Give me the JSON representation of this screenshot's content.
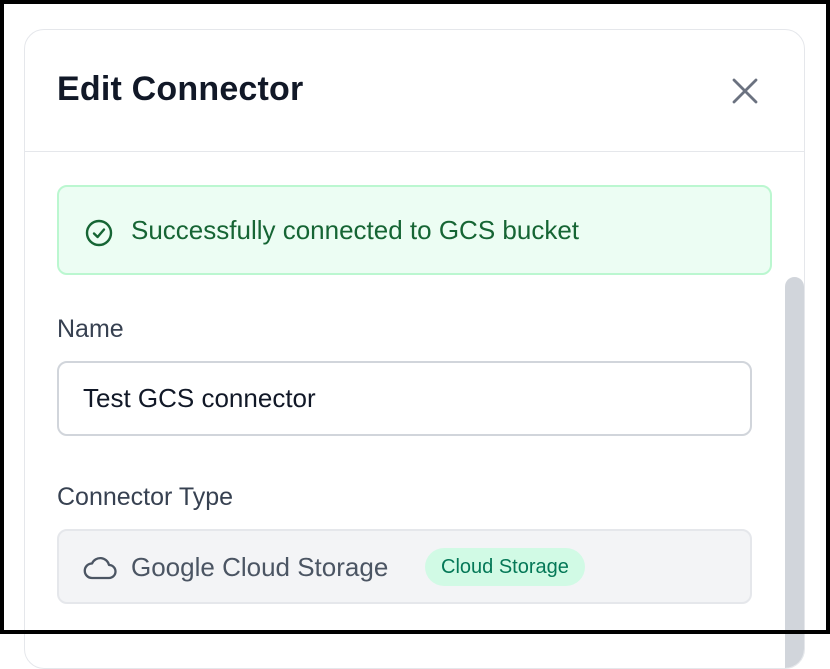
{
  "modal": {
    "title": "Edit Connector",
    "close_label": "Close"
  },
  "alert": {
    "message": "Successfully connected to GCS bucket",
    "status": "success",
    "icon": "check-circle-icon",
    "colors": {
      "background": "#ecfdf3",
      "border": "#bbf7d0",
      "text": "#166534"
    }
  },
  "form": {
    "name": {
      "label": "Name",
      "value": "Test GCS connector"
    },
    "connector_type": {
      "label": "Connector Type",
      "value": "Google Cloud Storage",
      "icon": "cloud-icon",
      "badge": "Cloud Storage"
    }
  }
}
